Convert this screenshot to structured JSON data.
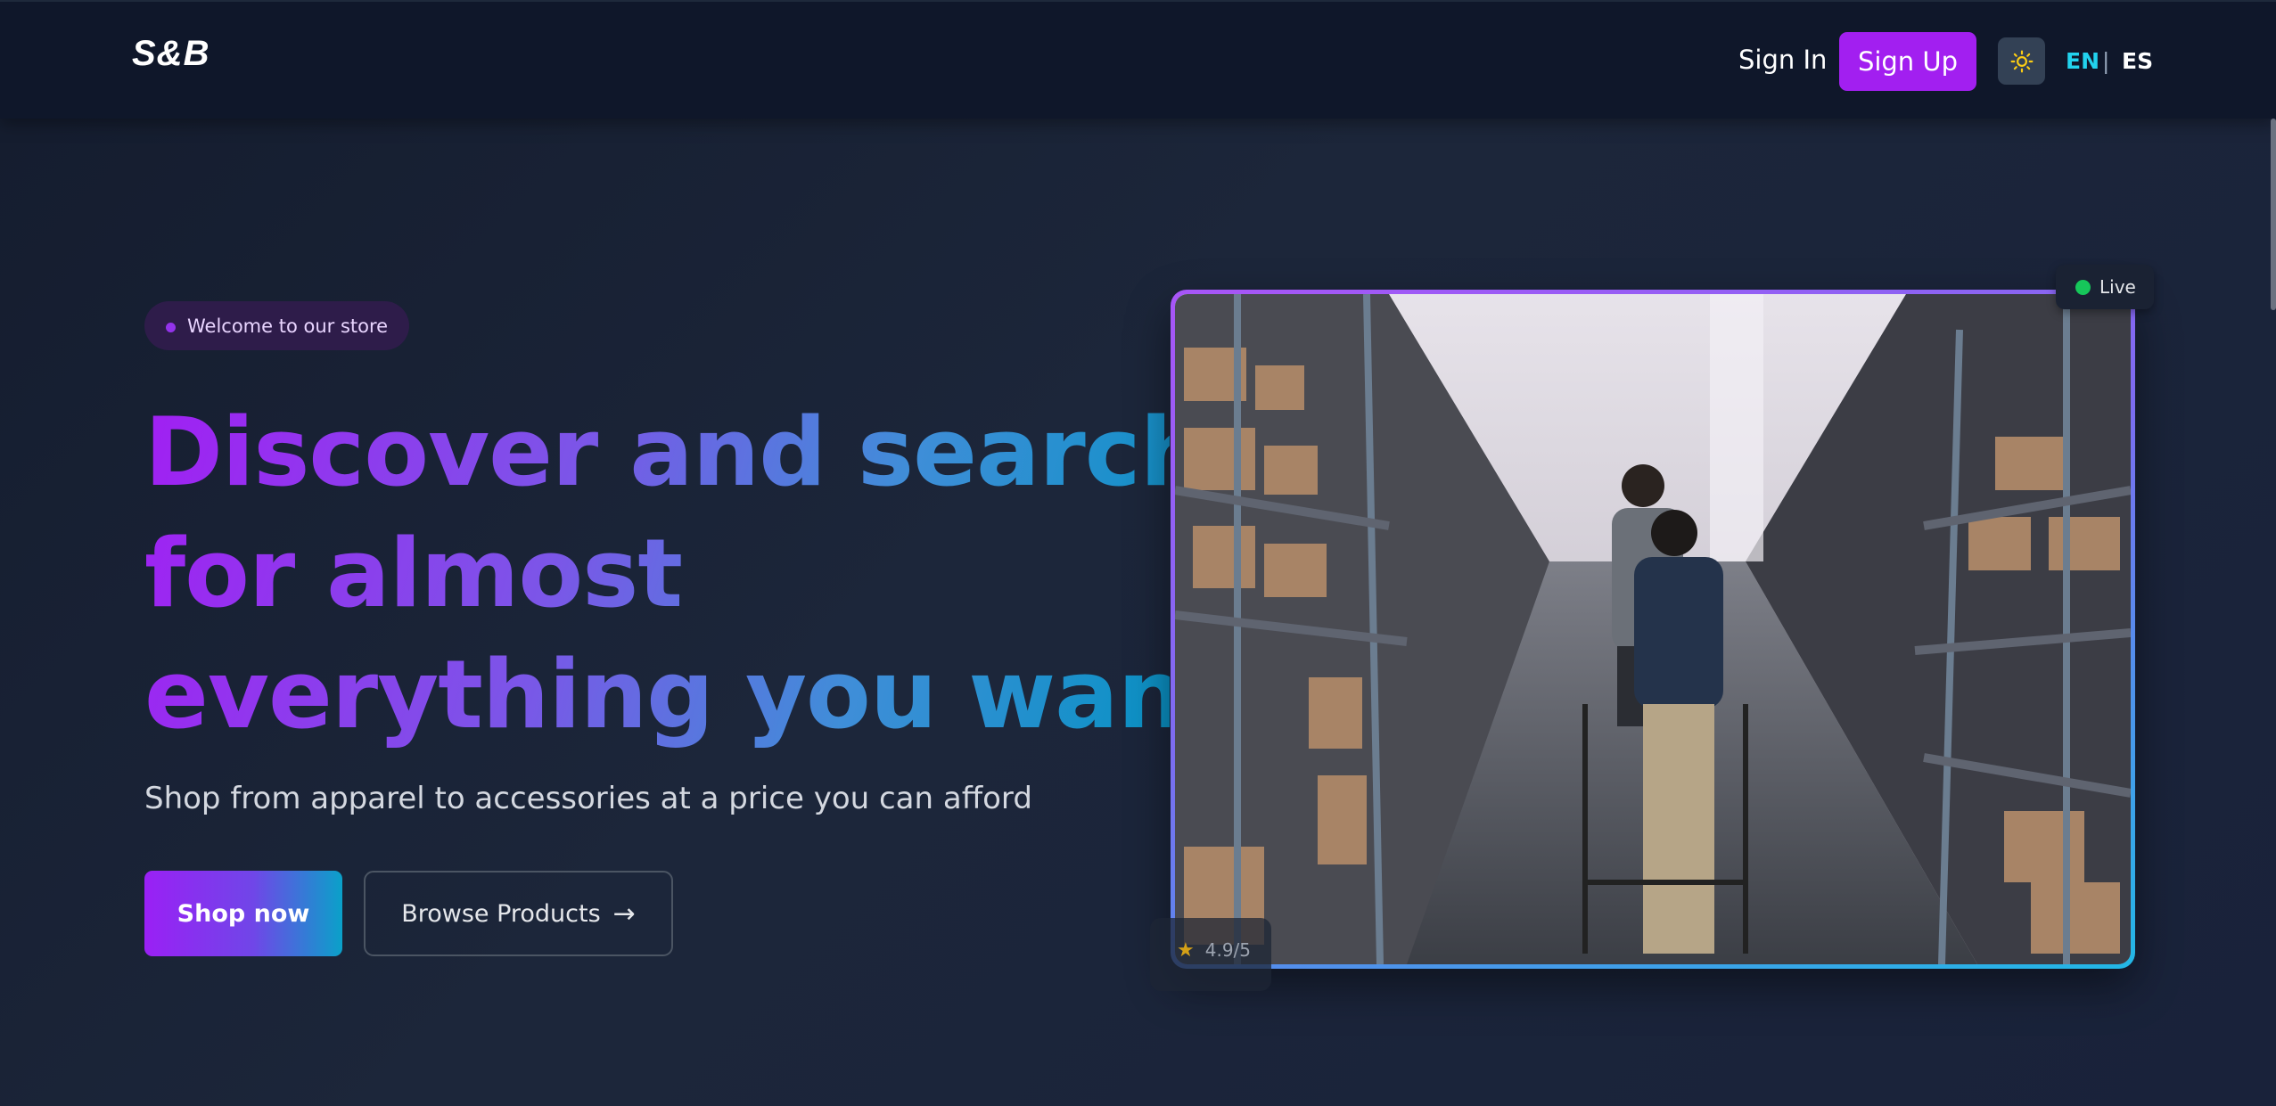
{
  "header": {
    "logo": "S&B",
    "sign_in": "Sign In",
    "sign_up": "Sign Up",
    "theme_icon": "sun-icon",
    "languages": [
      "EN",
      "ES"
    ],
    "lang_separator": "|",
    "active_language": "EN"
  },
  "hero": {
    "badge": "Welcome to our store",
    "headline_lines": [
      "Discover and search",
      "for almost",
      "everything you want"
    ],
    "subtitle": "Shop from apparel to accessories at a price you can afford",
    "shop_now": "Shop now",
    "browse_products": "Browse Products",
    "browse_icon": "arrow-right-icon"
  },
  "media": {
    "image_subject": "warehouse-aisle-photo",
    "live_label": "Live",
    "rating": "4.9/5",
    "rating_icon": "star-icon"
  },
  "colors": {
    "accent_purple": "#a21ff0",
    "accent_cyan": "#22d3ee",
    "live_green": "#16c65a",
    "header_bg": "#0f172a"
  }
}
